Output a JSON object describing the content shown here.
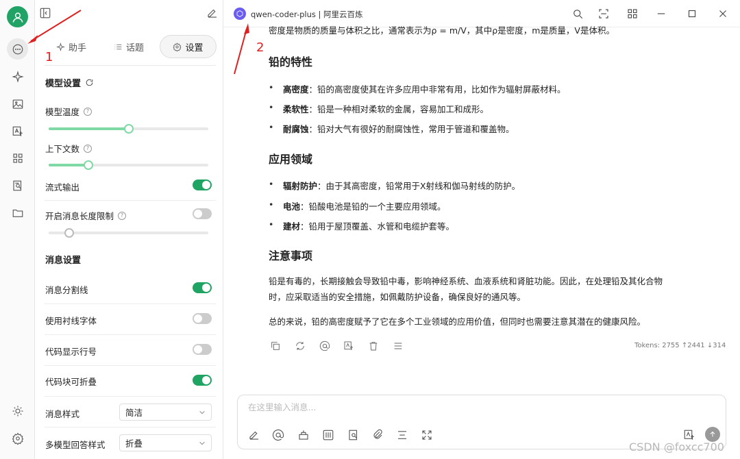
{
  "sidebar": {
    "icons": [
      "user-icon",
      "chat-icon",
      "sparkle-icon",
      "image-icon",
      "translate-icon",
      "apps-icon",
      "document-search-icon",
      "folder-icon",
      "sun-icon",
      "gear-icon"
    ]
  },
  "panel": {
    "tabs": [
      {
        "label": "助手",
        "icon": "sparkle-icon"
      },
      {
        "label": "话题",
        "icon": "list-icon"
      },
      {
        "label": "设置",
        "icon": "gear-icon",
        "active": true
      }
    ],
    "model_settings": {
      "title": "模型设置",
      "temperature": {
        "label": "模型温度",
        "value": 0.5
      },
      "context": {
        "label": "上下文数",
        "value": 0.25
      },
      "stream": {
        "label": "流式输出",
        "on": true
      },
      "max_length": {
        "label": "开启消息长度限制",
        "on": false,
        "value": 0.13
      }
    },
    "message_settings": {
      "title": "消息设置",
      "divider": {
        "label": "消息分割线",
        "on": true
      },
      "serif": {
        "label": "使用衬线字体",
        "on": false
      },
      "line_numbers": {
        "label": "代码显示行号",
        "on": false
      },
      "collapsible": {
        "label": "代码块可折叠",
        "on": true
      },
      "style": {
        "label": "消息样式",
        "value": "简洁"
      },
      "multi_model": {
        "label": "多模型回答样式",
        "value": "折叠"
      }
    }
  },
  "topbar": {
    "model": "qwen-coder-plus | 阿里云百炼"
  },
  "message": {
    "intro": "密度是物质的质量与体积之比，通常表示为ρ = m/V，其中ρ是密度，m是质量，V是体积。",
    "sections": [
      {
        "heading": "铅的特性",
        "items": [
          {
            "term": "高密度",
            "text": "：铅的高密度使其在许多应用中非常有用，比如作为辐射屏蔽材料。"
          },
          {
            "term": "柔软性",
            "text": "：铅是一种相对柔软的金属，容易加工和成形。"
          },
          {
            "term": "耐腐蚀",
            "text": "：铅对大气有很好的耐腐蚀性，常用于管道和覆盖物。"
          }
        ]
      },
      {
        "heading": "应用领域",
        "items": [
          {
            "term": "辐射防护",
            "text": "：由于其高密度，铅常用于X射线和伽马射线的防护。"
          },
          {
            "term": "电池",
            "text": "：铅酸电池是铅的一个主要应用领域。"
          },
          {
            "term": "建材",
            "text": "：铅用于屋顶覆盖、水管和电缆护套等。"
          }
        ]
      },
      {
        "heading": "注意事项",
        "para1": "铅是有毒的，长期接触会导致铅中毒，影响神经系统、血液系统和肾脏功能。因此，在处理铅及其化合物",
        "para2": "时，应采取适当的安全措施，如佩戴防护设备，确保良好的通风等。",
        "summary": "总的来说，铅的高密度赋予了它在多个工业领域的应用价值，但同时也需要注意其潜在的健康风险。"
      }
    ],
    "tokens": "Tokens: 2755 ↑2441 ↓314"
  },
  "composer": {
    "placeholder": "在这里输入消息..."
  },
  "annotations": {
    "one": "1",
    "two": "2"
  },
  "watermark": "CSDN @foxcc700",
  "colors": {
    "accent": "#1fa463",
    "annotation": "#e02020"
  }
}
